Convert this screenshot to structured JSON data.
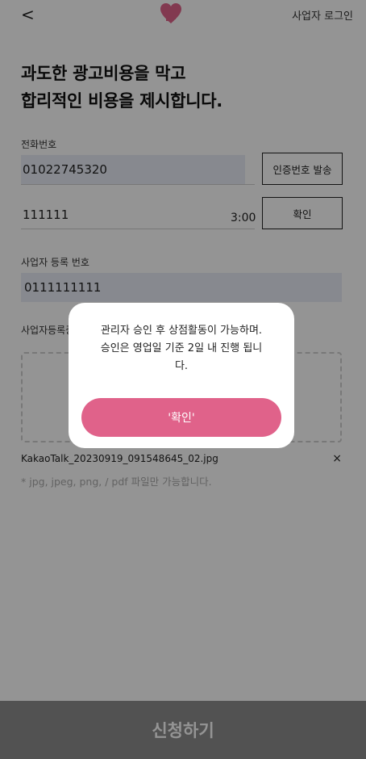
{
  "header": {
    "back_label": "<",
    "login_label": "사업자 로그인"
  },
  "headline": {
    "line1": "과도한 광고비용을 막고",
    "line2": "합리적인 비용을 제시합니다."
  },
  "phone": {
    "label": "전화번호",
    "value": "01022745320",
    "send_button": "인증번호 발송"
  },
  "verify": {
    "code": "111111",
    "timer": "3:00",
    "confirm_button": "확인"
  },
  "business": {
    "label": "사업자 등록 번호",
    "value": "0111111111",
    "cert_label": "사업자등록증"
  },
  "file": {
    "name": "KakaoTalk_20230919_091548645_02.jpg",
    "remove": "×",
    "hint": "* jpg, jpeg, png, / pdf 파일만 가능합니다."
  },
  "submit_label": "신청하기",
  "modal": {
    "message_line1": "관리자 승인 후 상점활동이 가능하며.",
    "message_line2": "승인은 영업일 기준 2일 내 진행 됩니",
    "message_line3": "다.",
    "button": "'확인'"
  },
  "colors": {
    "accent": "#e0628a",
    "input_fill": "#e8edf6"
  }
}
